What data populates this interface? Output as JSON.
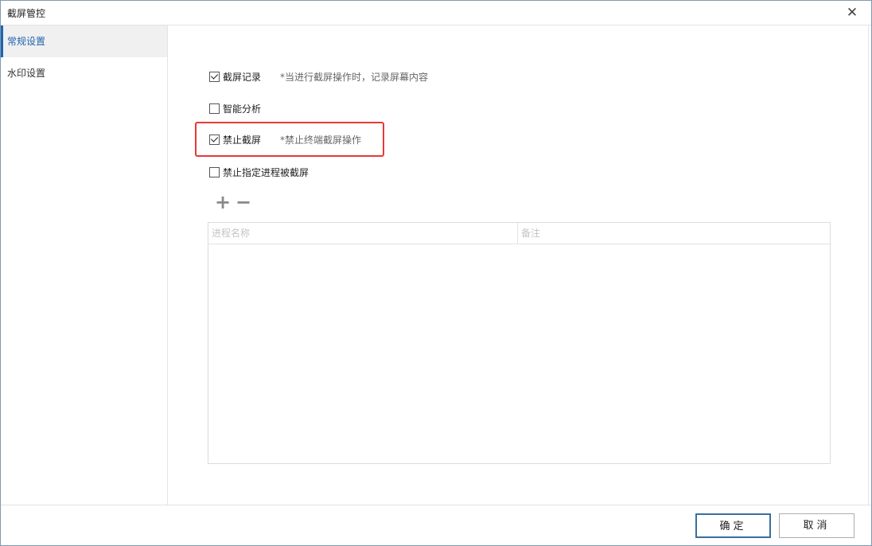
{
  "window": {
    "title": "截屏管控",
    "close_glyph": "✕"
  },
  "sidebar": {
    "items": [
      {
        "label": "常规设置",
        "active": true
      },
      {
        "label": "水印设置",
        "active": false
      }
    ]
  },
  "options": [
    {
      "label": "截屏记录",
      "checked": true,
      "hint": "*当进行截屏操作时，记录屏幕内容"
    },
    {
      "label": "智能分析",
      "checked": false,
      "hint": ""
    },
    {
      "label": "禁止截屏",
      "checked": true,
      "hint": "*禁止终端截屏操作"
    },
    {
      "label": "禁止指定进程被截屏",
      "checked": false,
      "hint": ""
    }
  ],
  "toolbar": {
    "add_glyph": "+",
    "remove_glyph": "−"
  },
  "table": {
    "columns": [
      "进程名称",
      "备注"
    ],
    "rows": []
  },
  "footer": {
    "ok_label": "确定",
    "cancel_label": "取消"
  },
  "colors": {
    "accent": "#1f64ae",
    "highlight": "#e53a35",
    "border": "#7e9bb3"
  }
}
